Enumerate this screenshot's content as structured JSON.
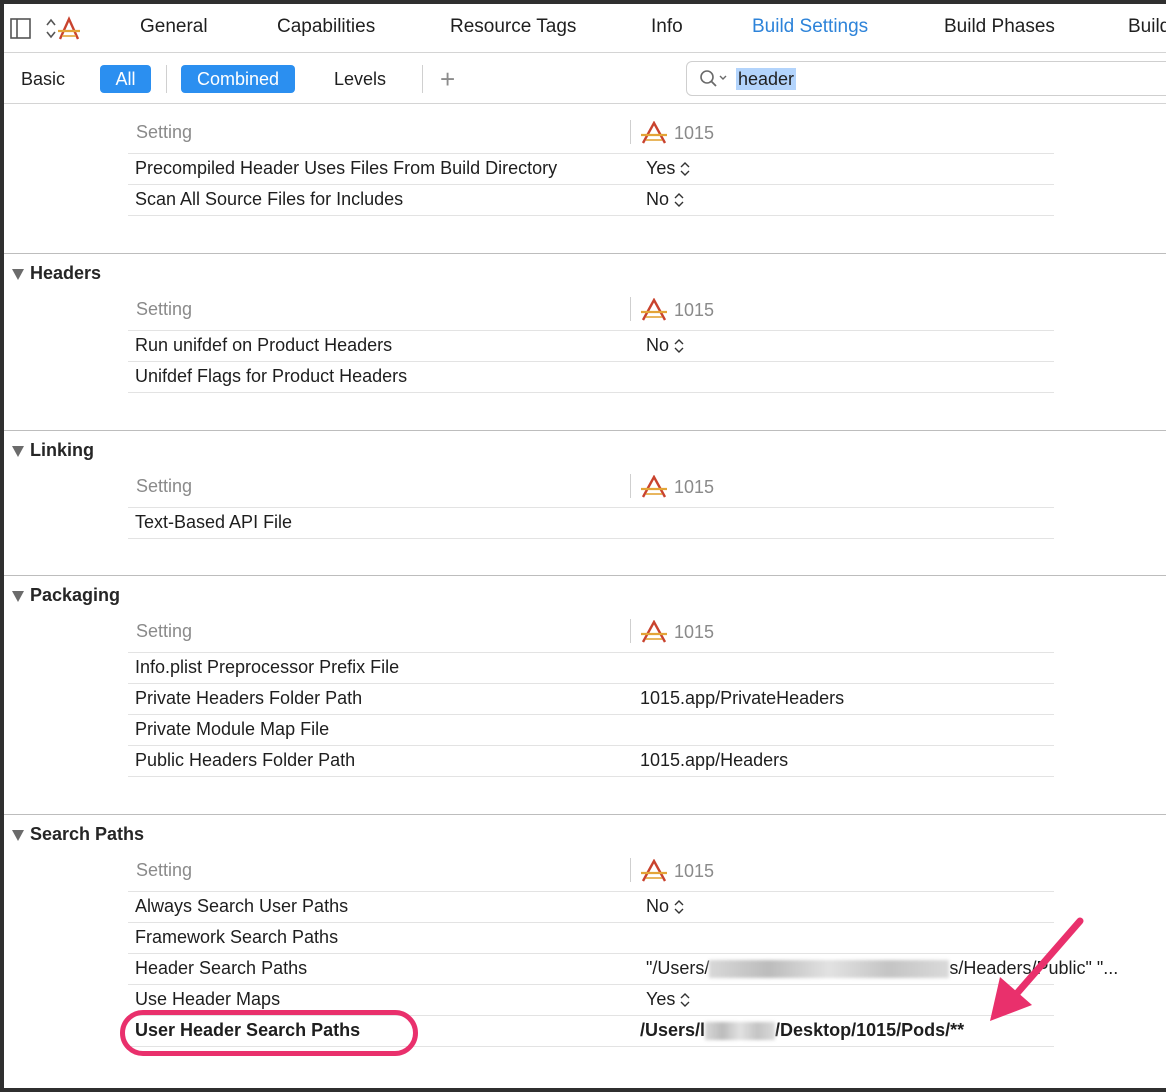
{
  "tabs": {
    "items": [
      {
        "label": "General"
      },
      {
        "label": "Capabilities"
      },
      {
        "label": "Resource Tags"
      },
      {
        "label": "Info"
      },
      {
        "label": "Build Settings"
      },
      {
        "label": "Build Phases"
      },
      {
        "label": "Build"
      }
    ],
    "active_tab": "Build Settings"
  },
  "filter": {
    "basic": "Basic",
    "all": "All",
    "combined": "Combined",
    "levels": "Levels",
    "add": "+",
    "search_value": "header"
  },
  "columns": {
    "setting": "Setting",
    "project": "1015"
  },
  "sections": [
    {
      "title": "",
      "rows": [
        {
          "name": "Precompiled Header Uses Files From Build Directory",
          "value": "Yes",
          "stepper": true
        },
        {
          "name": "Scan All Source Files for Includes",
          "value": "No",
          "stepper": true
        }
      ]
    },
    {
      "title": "Headers",
      "rows": [
        {
          "name": "Run unifdef on Product Headers",
          "value": "No",
          "stepper": true
        },
        {
          "name": "Unifdef Flags for Product Headers",
          "value": ""
        }
      ]
    },
    {
      "title": "Linking",
      "rows": [
        {
          "name": "Text-Based API File",
          "value": ""
        }
      ]
    },
    {
      "title": "Packaging",
      "rows": [
        {
          "name": "Info.plist Preprocessor Prefix File",
          "value": ""
        },
        {
          "name": "Private Headers Folder Path",
          "value": "1015.app/PrivateHeaders"
        },
        {
          "name": "Private Module Map File",
          "value": ""
        },
        {
          "name": "Public Headers Folder Path",
          "value": "1015.app/Headers"
        }
      ]
    },
    {
      "title": "Search Paths",
      "rows": [
        {
          "name": "Always Search User Paths",
          "value": "No",
          "stepper": true
        },
        {
          "name": "Framework Search Paths",
          "value": ""
        },
        {
          "name": "Header Search Paths",
          "value_prefix": "\"/Users/",
          "value_suffix": "s/Headers/Public\" \"..."
        },
        {
          "name": "Use Header Maps",
          "value": "Yes",
          "stepper": true
        },
        {
          "name": "User Header Search Paths",
          "value_prefix": "/Users/l",
          "value_suffix": "/Desktop/1015/Pods/**",
          "bold": true
        }
      ]
    }
  ],
  "colors": {
    "accent": "#2b8ff0",
    "active_tab": "#2d83d9",
    "annotation": "#e9306c"
  }
}
